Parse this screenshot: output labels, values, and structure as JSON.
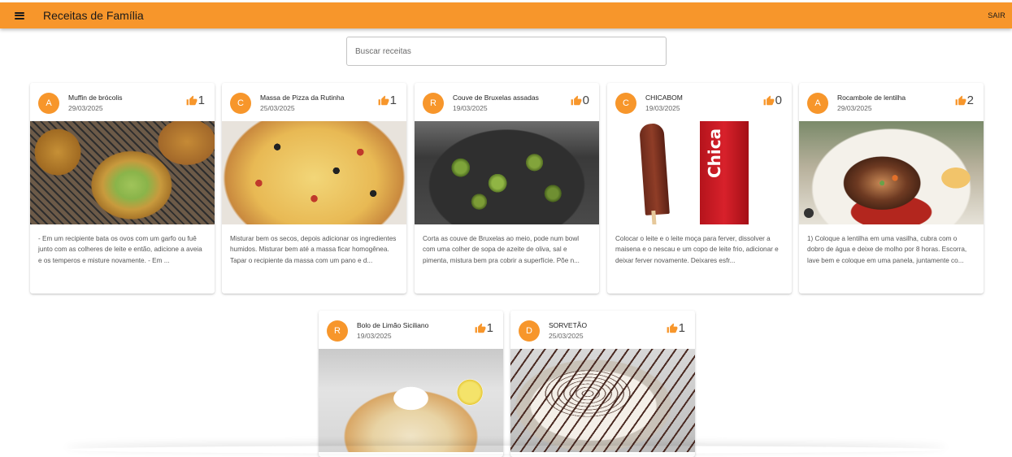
{
  "appbar": {
    "title": "Receitas de Família",
    "logout_label": "SAIR",
    "accent_color": "#f7962b",
    "menu_icon": "menu-icon"
  },
  "search": {
    "placeholder": "Buscar receitas",
    "value": ""
  },
  "recipes": [
    {
      "avatar": "A",
      "title": "Muffin de brócolis",
      "date": "29/03/2025",
      "likes": "1",
      "excerpt": "- Em um recipiente bata os ovos com um garfo ou fuê junto com as colheres de leite e então, adicione a aveia e os temperos e misture novamente. - Em ..."
    },
    {
      "avatar": "C",
      "title": "Massa de Pizza da Rutinha",
      "date": "25/03/2025",
      "likes": "1",
      "excerpt": "Misturar bem os secos, depois adicionar os ingredientes humidos. Misturar bem até a massa ficar homogênea. Tapar o recipiente da massa com um pano e d..."
    },
    {
      "avatar": "R",
      "title": "Couve de Bruxelas assadas",
      "date": "19/03/2025",
      "likes": "0",
      "excerpt": "Corta as couve de Bruxelas ao meio, pode num bowl com uma colher de sopa de azeite de oliva, sal e pimenta, mistura bem pra cobrir a superfície. Põe n..."
    },
    {
      "avatar": "C",
      "title": "CHICABOM",
      "date": "19/03/2025",
      "likes": "0",
      "excerpt": "Colocar o leite e o leite moça para ferver, dissolver a maisena e o nescau e um copo de leite frio, adicionar e deixar ferver novamente. Deixares esfr...",
      "image_text": "Chica Bon"
    },
    {
      "avatar": "A",
      "title": "Rocambole de lentilha",
      "date": "29/03/2025",
      "likes": "2",
      "excerpt": "1) Coloque a lentilha em uma vasilha, cubra com o dobro de água e deixe de molho por 8 horas. Escorra, lave bem e coloque em uma panela, juntamente co..."
    },
    {
      "avatar": "R",
      "title": "Bolo de Limão Siciliano",
      "date": "19/03/2025",
      "likes": "1",
      "excerpt": ""
    },
    {
      "avatar": "D",
      "title": "SORVETÃO",
      "date": "25/03/2025",
      "likes": "1",
      "excerpt": ""
    }
  ]
}
